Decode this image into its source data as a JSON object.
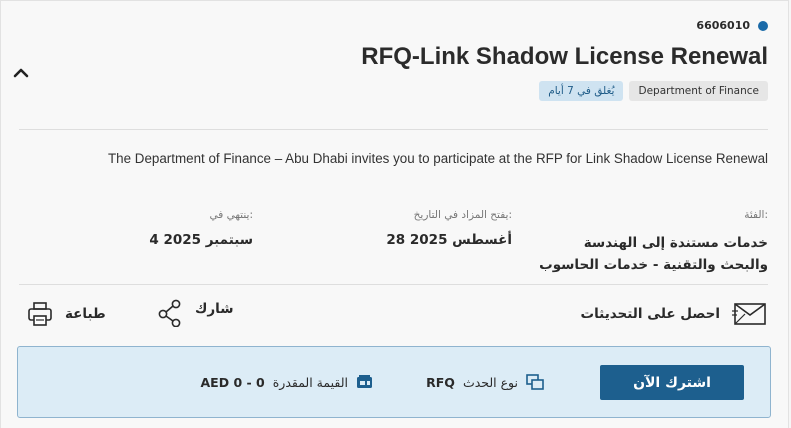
{
  "rfq": {
    "id": "6606010",
    "title": "RFQ-Link Shadow License Renewal",
    "department_badge": "Department of Finance",
    "closing_badge": "يُغلق في 7 أيام",
    "description": "The Department of Finance – Abu Dhabi invites you to participate at the RFP for Link Shadow License Renewal"
  },
  "meta": {
    "category_label": "الفئة:",
    "category_line1": "خدمات مستندة إلى الهندسة",
    "category_line2": "والبحث والتقنية - خدمات الحاسوب",
    "opens_label": "يفتح المزاد في التاريخ:",
    "opens_value": "28 أغسطس 2025",
    "ends_label": "ينتهي في:",
    "ends_value": "4 سبتمبر 2025"
  },
  "actions": {
    "updates_label": "احصل على التحديثات",
    "share_label": "شارك",
    "print_label": "طباعة"
  },
  "footer": {
    "subscribe_label": "اشترك الآن",
    "event_type_label": "نوع الحدث",
    "event_type_value": "RFQ",
    "estimated_label": "القيمة المقدرة",
    "estimated_value": "AED 0 - 0"
  },
  "colors": {
    "accent": "#1d5f8e",
    "dot": "#1a6aa8",
    "footer_bg": "#dcecf6",
    "closing_badge_bg": "#cfe3f1"
  },
  "icons": [
    "chevron-up-icon",
    "mail-icon",
    "share-icon",
    "printer-icon",
    "event-type-icon",
    "wallet-icon"
  ]
}
